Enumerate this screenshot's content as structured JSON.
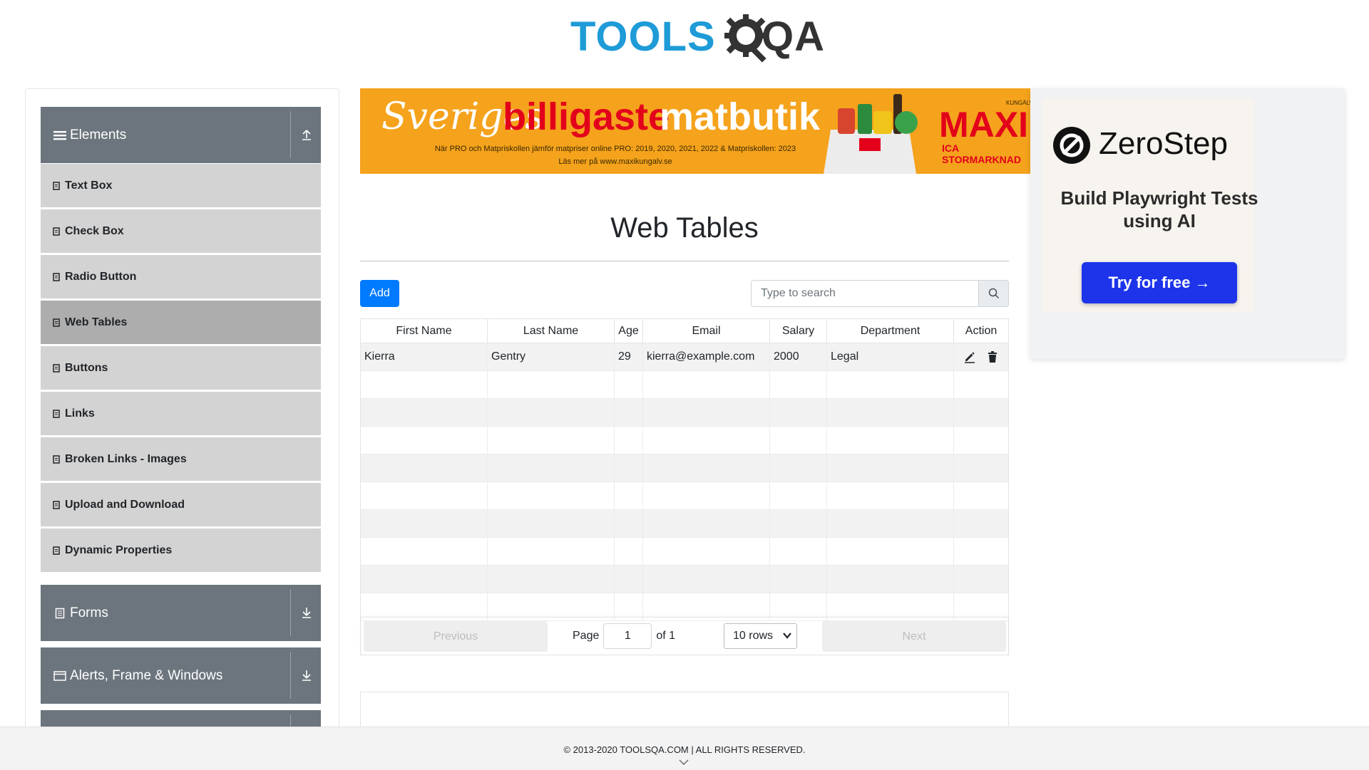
{
  "header": {
    "logo_text_tools": "TOOLS",
    "logo_text_qa": "QA",
    "logo_icon": "gear-icon"
  },
  "sidebar": {
    "groups": [
      {
        "label": "Elements",
        "icon": "hamburger-icon",
        "toggle_icon": "arrow-up-icon",
        "expanded": true
      },
      {
        "label": "Forms",
        "icon": "form-icon",
        "toggle_icon": "arrow-down-icon",
        "expanded": false
      },
      {
        "label": "Alerts, Frame & Windows",
        "icon": "window-icon",
        "toggle_icon": "arrow-down-icon",
        "expanded": false
      }
    ],
    "items": [
      {
        "label": "Text Box"
      },
      {
        "label": "Check Box"
      },
      {
        "label": "Radio Button"
      },
      {
        "label": "Web Tables",
        "active": true
      },
      {
        "label": "Buttons"
      },
      {
        "label": "Links"
      },
      {
        "label": "Broken Links - Images"
      },
      {
        "label": "Upload and Download"
      },
      {
        "label": "Dynamic Properties"
      }
    ]
  },
  "banner": {
    "script_text": "Sveriges",
    "headline_red": "billigaste",
    "headline_white": "matbutik",
    "subtext_1": "När PRO och Matpriskollen jämför matpriser online PRO: 2019, 2020, 2021, 2022 & Matpriskollen: 2023",
    "subtext_2": "Läs mer på www.maxikungalv.se",
    "brand": "MAXI",
    "brand_sub": "ICA STORMARKNAD",
    "brand_top": "KUNGÄLV"
  },
  "right_ad": {
    "brand": "ZeroStep",
    "text": "Build Playwright Tests using AI",
    "button_label": "Try for free →"
  },
  "main": {
    "title": "Web Tables",
    "add_label": "Add",
    "search_placeholder": "Type to search",
    "columns": [
      "First Name",
      "Last Name",
      "Age",
      "Email",
      "Salary",
      "Department",
      "Action"
    ],
    "rows": [
      {
        "first_name": "Kierra",
        "last_name": "Gentry",
        "age": "29",
        "email": "kierra@example.com",
        "salary": "2000",
        "department": "Legal"
      }
    ],
    "pagination": {
      "previous_label": "Previous",
      "next_label": "Next",
      "page_label": "Page",
      "page_value": "1",
      "of_label": "of 1",
      "rows_select": "10 rows"
    }
  },
  "footer": {
    "text": "© 2013-2020 TOOLSQA.COM | ALL RIGHTS RESERVED."
  },
  "colors": {
    "primary": "#007bff",
    "sidebar_header": "#6c757d",
    "menu_item": "#d3d3d3",
    "menu_item_active": "#adadad",
    "logo_blue": "#1f9bd7"
  }
}
